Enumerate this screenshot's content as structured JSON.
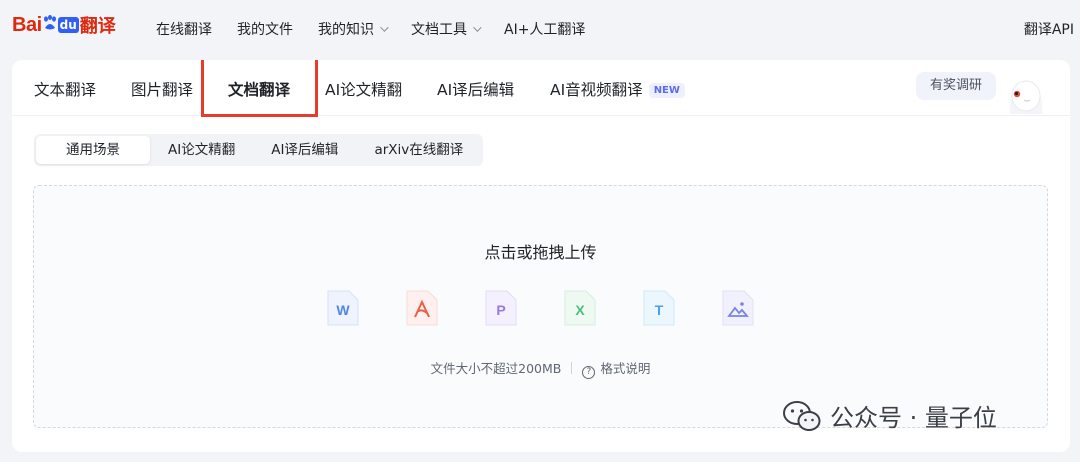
{
  "logo": {
    "part1": "Bai",
    "part2": "du",
    "part3": "翻译"
  },
  "nav": [
    {
      "label": "在线翻译"
    },
    {
      "label": "我的文件"
    },
    {
      "label": "我的知识"
    },
    {
      "label": "文档工具"
    },
    {
      "label": "AI+人工翻译"
    }
  ],
  "api_label": "翻译API",
  "tabs": [
    {
      "label": "文本翻译"
    },
    {
      "label": "图片翻译"
    },
    {
      "label": "文档翻译"
    },
    {
      "label": "AI论文精翻"
    },
    {
      "label": "AI译后编辑"
    },
    {
      "label": "AI音视频翻译",
      "badge": "NEW"
    }
  ],
  "survey_label": "有奖调研",
  "subtabs": [
    {
      "label": "通用场景"
    },
    {
      "label": "AI论文精翻"
    },
    {
      "label": "AI译后编辑"
    },
    {
      "label": "arXiv在线翻译"
    }
  ],
  "upload": {
    "title": "点击或拖拽上传",
    "file_types": [
      "W",
      "PDF",
      "P",
      "X",
      "T",
      "image"
    ],
    "size_limit": "文件大小不超过200MB",
    "format_help": "格式说明"
  },
  "watermark": {
    "text": "公众号 · 量子位"
  },
  "colors": {
    "brand_red": "#de2910",
    "highlight": "#e83b2b",
    "accent_blue": "#2f5ff5"
  }
}
